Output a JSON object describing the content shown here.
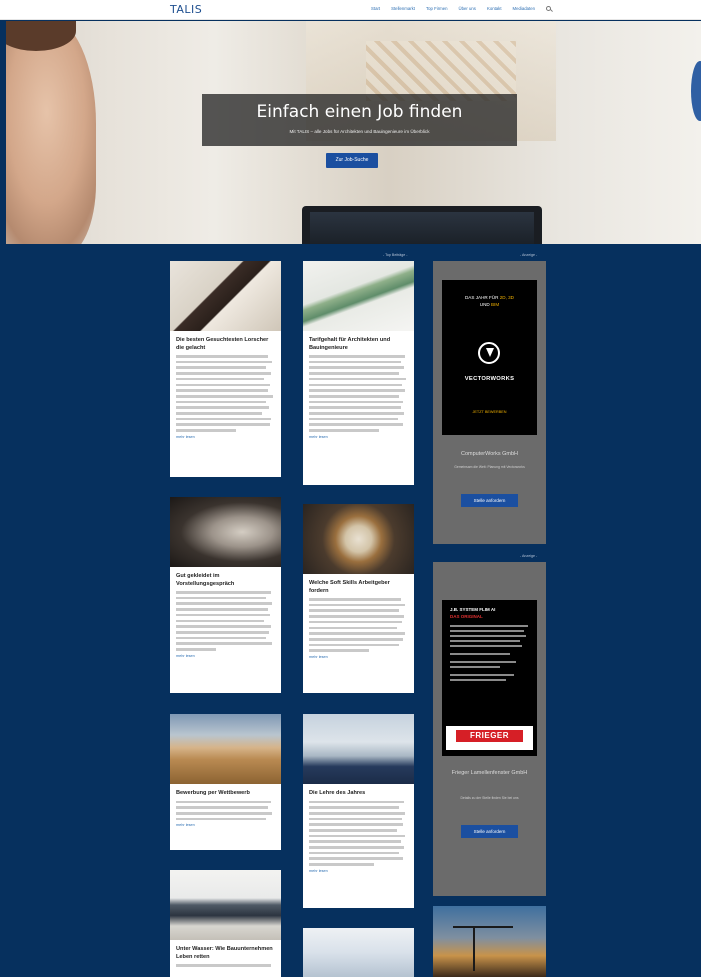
{
  "header": {
    "logo": "TALIS",
    "nav": [
      "Start",
      "Stellenmarkt",
      "Top Firmen",
      "Über uns",
      "Kontakt",
      "Mediadaten"
    ]
  },
  "hero": {
    "title": "Einfach einen Job finden",
    "subtitle": "Mit TALIS – alle Jobs für Architekten und Bauingenieure im Überblick",
    "button": "Zur Job-Suche"
  },
  "labels": {
    "top_center": "- Top Beiträge -",
    "ad_top": "- Anzeige -",
    "ad_mid": "- Anzeige -"
  },
  "cards": [
    {
      "title": "Die besten Gesuchtesten Lorscher die gelacht",
      "more": "mehr lesen"
    },
    {
      "title": "Tarifgehalt für Architekten und Bauingenieure",
      "more": "mehr lesen"
    },
    {
      "title": "Gut gekleidet im Vorstellungsgespräch",
      "more": "mehr lesen"
    },
    {
      "title": "Welche Soft Skills Arbeitgeber fordern",
      "more": "mehr lesen"
    },
    {
      "title": "Bewerbung per Wettbewerb",
      "more": "mehr lesen"
    },
    {
      "title": "Die Lehre des Jahres",
      "more": "mehr lesen"
    },
    {
      "title": "Unter Wasser: Wie Bauunternehmen Leben retten",
      "more": ""
    },
    {
      "title": "",
      "more": ""
    }
  ],
  "ads": [
    {
      "headline_top": "DAS JAHR FÜR",
      "headline_highlight": "2D, 3D",
      "headline_mid": "UND",
      "headline_end": "BIM",
      "brand": "VECTORWORKS",
      "cta_line": "JETZT BEWERBEN",
      "company": "ComputerWorks GmbH",
      "company_desc": "Gemeinsam die Welt: Planung mit Vectorworks",
      "button": "Stelle anfordern"
    },
    {
      "headline": "J.B. SYSTEM FLIM AI",
      "headline_tag": "DAS ORIGINAL",
      "brand": "FRIEGER",
      "company": "Frieger Lamellenfenster GmbH",
      "company_desc": "Details zu der Stelle finden Sie bei uns",
      "button": "Stelle anfordern"
    }
  ],
  "colors": {
    "background": "#06305e",
    "accent": "#1b4fa0",
    "ad_panel": "#6b6b6b"
  }
}
